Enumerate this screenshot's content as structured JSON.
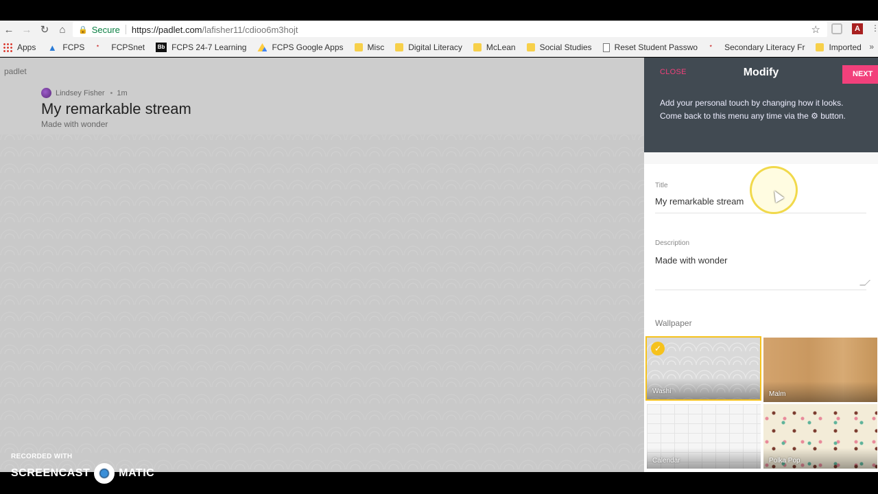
{
  "browser": {
    "secure_label": "Secure",
    "url_host": "https://padlet.com",
    "url_path": "/lafisher11/cdioo6m3hojt"
  },
  "bookmarks": [
    {
      "label": "Apps"
    },
    {
      "label": "FCPS"
    },
    {
      "label": "FCPSnet"
    },
    {
      "label": "FCPS 24-7 Learning"
    },
    {
      "label": "FCPS Google Apps"
    },
    {
      "label": "Misc"
    },
    {
      "label": "Digital Literacy"
    },
    {
      "label": "McLean"
    },
    {
      "label": "Social Studies"
    },
    {
      "label": "Reset Student Passwo"
    },
    {
      "label": "Secondary Literacy Fr"
    },
    {
      "label": "Imported"
    }
  ],
  "board": {
    "brand": "padlet",
    "author": "Lindsey Fisher",
    "time": "1m",
    "title": "My remarkable stream",
    "description": "Made with wonder"
  },
  "panel": {
    "close_label": "CLOSE",
    "heading": "Modify",
    "next_label": "NEXT",
    "intro": "Add your personal touch by changing how it looks. Come back to this menu any time via the ⚙ button.",
    "title_label": "Title",
    "title_value": "My remarkable stream",
    "description_label": "Description",
    "description_value": "Made with wonder",
    "wallpaper_label": "Wallpaper",
    "wallpapers": [
      {
        "label": "Washi",
        "selected": true
      },
      {
        "label": "Malm",
        "selected": false
      },
      {
        "label": "Calendar",
        "selected": false
      },
      {
        "label": "Polka Pop",
        "selected": false
      }
    ]
  },
  "watermark": {
    "top": "RECORDED WITH",
    "left": "SCREENCAST",
    "right": "MATIC"
  },
  "colors": {
    "accent": "#f2407b",
    "panel_header": "#414a52",
    "selected_border": "#f6c21c"
  }
}
